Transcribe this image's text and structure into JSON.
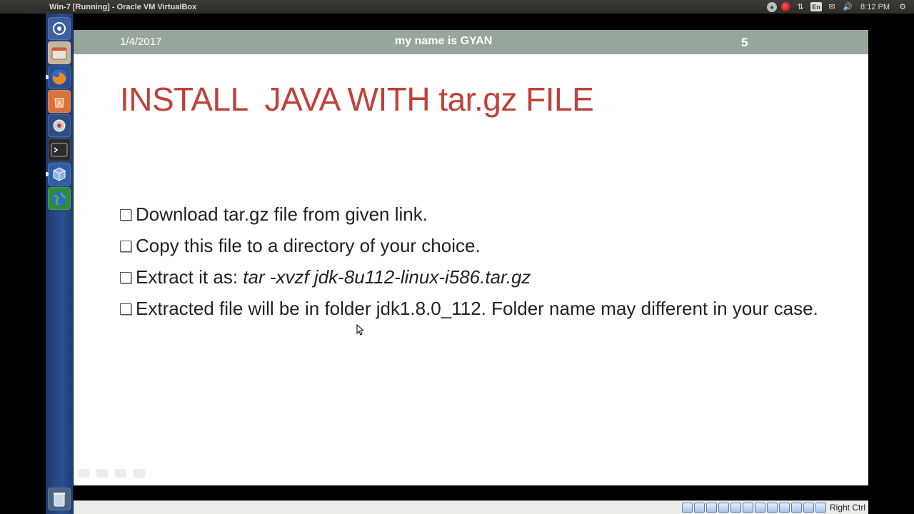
{
  "window": {
    "title": "Win-7 [Running] - Oracle VM VirtualBox"
  },
  "panel": {
    "keyboard_layout": "En",
    "clock": "8:12 PM",
    "indicator_icons": [
      "cloud-icon",
      "record-icon",
      "network-icon",
      "keyboard-layout-icon",
      "mail-icon",
      "volume-icon",
      "gear-icon"
    ]
  },
  "launcher": {
    "items": [
      {
        "name": "dash-home-icon",
        "color": "#3b5fa0"
      },
      {
        "name": "files-icon",
        "color": "#8a6a4a"
      },
      {
        "name": "firefox-icon",
        "color": "#e0701a"
      },
      {
        "name": "software-center-icon",
        "color": "#d8743a"
      },
      {
        "name": "system-settings-icon",
        "color": "#b04a3a"
      },
      {
        "name": "terminal-icon",
        "color": "#2b2b2b"
      },
      {
        "name": "virtualbox-icon",
        "color": "#2f5fa5"
      },
      {
        "name": "globe-icon",
        "color": "#2f8a3a"
      },
      {
        "name": "trash-icon",
        "color": "#6d7f9a"
      }
    ]
  },
  "slide": {
    "header": {
      "date": "1/4/2017",
      "author": "my name is GYAN",
      "number": "5"
    },
    "title": "INSTALL  JAVA WITH tar.gz FILE",
    "bullets": {
      "b1": "Download tar.gz file from given link.",
      "b2": "Copy this file to a directory of your choice.",
      "b3_prefix": "Extract it as: ",
      "b3_command": "tar -xvzf jdk-8u112-linux-i586.tar.gz",
      "b4": "Extracted file will be in folder jdk1.8.0_112. Folder name may different in your case."
    }
  },
  "status_bar": {
    "host_key": "Right Ctrl"
  },
  "colors": {
    "header_bg": "#97a69a",
    "title_red": "#c0413a",
    "launcher_blue": "#2a4f8e"
  }
}
